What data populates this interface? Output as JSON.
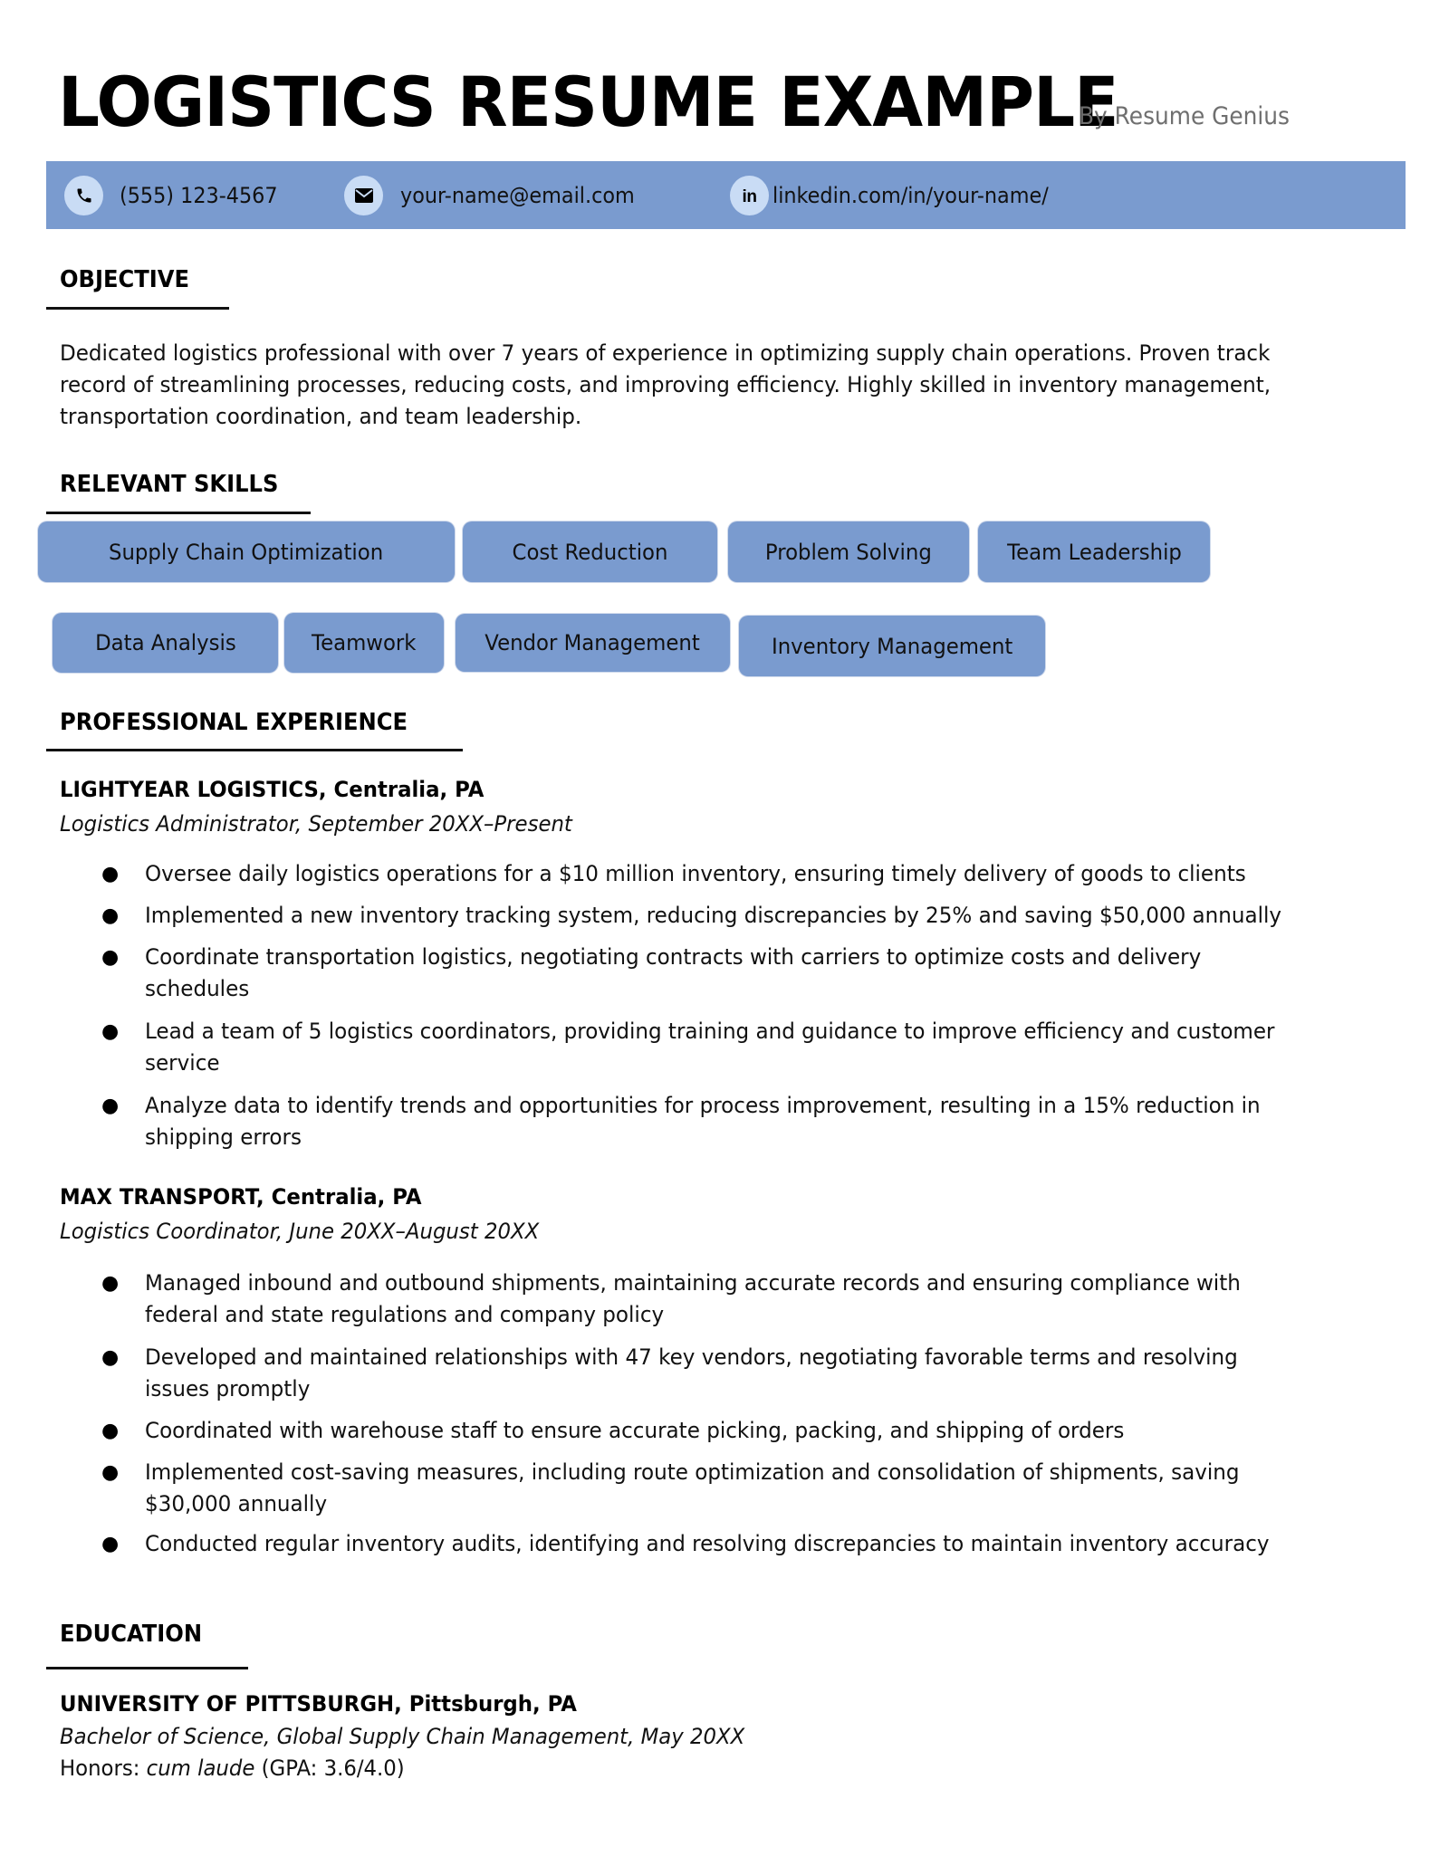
{
  "header": {
    "title": "LOGISTICS RESUME EXAMPLE",
    "byline": "By Resume Genius"
  },
  "contact": {
    "bar_color": "#7A9BCF",
    "icon_bg_color": "#C9DCF5",
    "phone": {
      "icon": "phone-icon",
      "text": "(555) 123-4567"
    },
    "email": {
      "icon": "envelope-icon",
      "text": "your-name@email.com"
    },
    "linkedin": {
      "icon": "linkedin-icon",
      "glyph": "in",
      "text": "linkedin.com/in/your-name/"
    }
  },
  "objective": {
    "heading": "OBJECTIVE",
    "text": "Dedicated logistics professional with over 7 years of experience in optimizing supply chain operations. Proven track record of streamlining processes, reducing costs, and improving efficiency. Highly skilled in inventory management, transportation coordination, and team leadership."
  },
  "skills": {
    "heading": "RELEVANT SKILLS",
    "pill_color": "#7A9BCF",
    "items": [
      "Supply Chain Optimization",
      "Cost Reduction",
      "Problem Solving",
      "Team Leadership",
      "Data Analysis",
      "Teamwork",
      "Vendor Management",
      "Inventory Management"
    ]
  },
  "experience": {
    "heading": "PROFESSIONAL EXPERIENCE",
    "jobs": [
      {
        "company": "LIGHTYEAR LOGISTICS, Centralia, PA",
        "role": "Logistics Administrator, September 20XX–Present",
        "bullets": [
          "Oversee daily logistics operations for a $10 million inventory, ensuring timely delivery of goods to clients",
          "Implemented a new inventory tracking system, reducing discrepancies by 25% and saving $50,000 annually",
          "Coordinate transportation logistics, negotiating contracts with carriers to optimize costs and delivery schedules",
          "Lead a team of 5 logistics coordinators, providing training and guidance to improve efficiency and customer service",
          "Analyze data to identify trends and opportunities for process improvement, resulting in a 15% reduction in shipping errors"
        ]
      },
      {
        "company": "MAX TRANSPORT, Centralia, PA",
        "role": "Logistics Coordinator, June 20XX–August 20XX",
        "bullets": [
          "Managed inbound and outbound shipments, maintaining accurate records and ensuring compliance with federal and state regulations and company policy",
          "Developed and maintained relationships with 47 key vendors, negotiating favorable terms and resolving issues promptly",
          "Coordinated with warehouse staff to ensure accurate picking, packing, and shipping of orders",
          "Implemented cost-saving measures, including route optimization and consolidation of shipments, saving $30,000 annually",
          "Conducted regular inventory audits, identifying and resolving discrepancies to maintain inventory accuracy"
        ]
      }
    ]
  },
  "education": {
    "heading": "EDUCATION",
    "school": "UNIVERSITY OF PITTSBURGH, Pittsburgh, PA",
    "degree": "Bachelor of Science, Global Supply Chain Management, May 20XX",
    "honors_label": "Honors: ",
    "honors_value": "cum laude",
    "gpa": " (GPA: 3.6/4.0)"
  }
}
